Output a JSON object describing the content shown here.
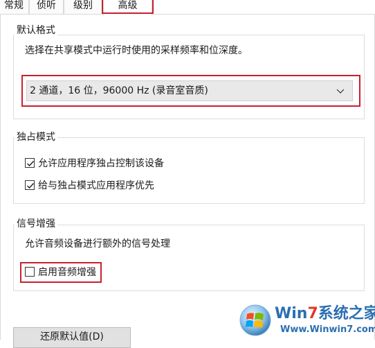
{
  "tabs": [
    {
      "label": "常规",
      "active": false
    },
    {
      "label": "侦听",
      "active": false
    },
    {
      "label": "级别",
      "active": false
    },
    {
      "label": "高级",
      "active": true
    }
  ],
  "default_format": {
    "title": "默认格式",
    "description": "选择在共享模式中运行时使用的采样频率和位深度。",
    "selected_value": "2 通道，16 位，96000 Hz (录音室音质)"
  },
  "exclusive_mode": {
    "title": "独占模式",
    "options": [
      {
        "label": "允许应用程序独占控制该设备",
        "checked": true
      },
      {
        "label": "给与独占模式应用程序优先",
        "checked": true
      }
    ]
  },
  "signal_enhancement": {
    "title": "信号增强",
    "description": "允许音频设备进行额外的信号处理",
    "option": {
      "label": "启用音频增强",
      "checked": false
    }
  },
  "restore_button": "还原默认值(D)",
  "watermark": {
    "title_part1": "Win",
    "title_seven": "7",
    "title_part2": "系统之家",
    "url": "Www.Winwin7.com"
  },
  "colors": {
    "highlight_red": "#c8202f",
    "group_border": "#dcdcdc",
    "dropdown_bg": "#e9e9e9"
  }
}
